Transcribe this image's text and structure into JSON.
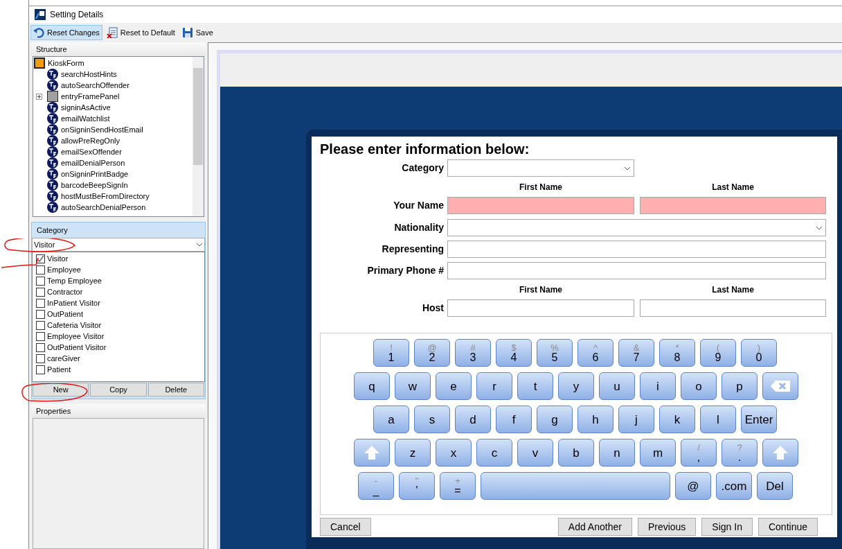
{
  "window": {
    "title": "Setting Details"
  },
  "toolbar": [
    {
      "label": "Reset Changes",
      "kind": "undo",
      "highlighted": true
    },
    {
      "label": "Reset to Default",
      "kind": "reset",
      "highlighted": false
    },
    {
      "label": "Save",
      "kind": "save",
      "highlighted": false
    }
  ],
  "structure": {
    "title": "Structure",
    "items": [
      {
        "label": "KioskForm",
        "kind": "root"
      },
      {
        "label": "searchHostHints",
        "kind": "boolean"
      },
      {
        "label": "autoSearchOffender",
        "kind": "boolean"
      },
      {
        "label": "entryFramePanel",
        "kind": "panel",
        "expanded": false
      },
      {
        "label": "signinAsActive",
        "kind": "boolean"
      },
      {
        "label": "emailWatchlist",
        "kind": "boolean"
      },
      {
        "label": "onSigninSendHostEmail",
        "kind": "boolean"
      },
      {
        "label": "allowPreRegOnly",
        "kind": "boolean"
      },
      {
        "label": "emailSexOffender",
        "kind": "boolean"
      },
      {
        "label": "emailDenialPerson",
        "kind": "boolean"
      },
      {
        "label": "onSigninPrintBadge",
        "kind": "boolean"
      },
      {
        "label": "barcodeBeepSignIn",
        "kind": "boolean"
      },
      {
        "label": "hostMustBeFromDirectory",
        "kind": "boolean"
      },
      {
        "label": "autoSearchDenialPerson",
        "kind": "boolean"
      }
    ]
  },
  "category": {
    "title": "Category",
    "value": "Visitor",
    "items": [
      {
        "label": "Visitor",
        "checked": true
      },
      {
        "label": "Employee",
        "checked": false
      },
      {
        "label": "Temp Employee",
        "checked": false
      },
      {
        "label": "Contractor",
        "checked": false
      },
      {
        "label": "InPatient Visitor",
        "checked": false
      },
      {
        "label": "OutPatient",
        "checked": false
      },
      {
        "label": "Cafeteria Visitor",
        "checked": false
      },
      {
        "label": "Employee Visitor",
        "checked": false
      },
      {
        "label": "OutPatient Visitor",
        "checked": false
      },
      {
        "label": "careGiver",
        "checked": false
      },
      {
        "label": "Patient",
        "checked": false
      }
    ],
    "buttons": [
      "New",
      "Copy",
      "Delete"
    ]
  },
  "properties": {
    "title": "Properties"
  },
  "form": {
    "heading": "Please enter information below:",
    "rows": [
      {
        "kind": "short_select",
        "label": "Category"
      },
      {
        "kind": "column_headers",
        "first": "First Name",
        "second": "Last Name"
      },
      {
        "kind": "name_pair",
        "label": "Your Name",
        "invalid": true
      },
      {
        "kind": "select",
        "label": "Nationality"
      },
      {
        "kind": "text",
        "label": "Representing"
      },
      {
        "kind": "text",
        "label": "Primary Phone #"
      },
      {
        "kind": "column_headers",
        "first": "First Name",
        "second": "Last Name"
      },
      {
        "kind": "name_pair",
        "label": "Host",
        "invalid": false
      }
    ]
  },
  "keyboard": [
    [
      {
        "kind": "char",
        "alt": "!",
        "label": "1"
      },
      {
        "kind": "char",
        "alt": "@",
        "label": "2"
      },
      {
        "kind": "char",
        "alt": "#",
        "label": "3"
      },
      {
        "kind": "char",
        "alt": "$",
        "label": "4"
      },
      {
        "kind": "char",
        "alt": "%",
        "label": "5"
      },
      {
        "kind": "char",
        "alt": "^",
        "label": "6"
      },
      {
        "kind": "char",
        "alt": "&",
        "label": "7"
      },
      {
        "kind": "char",
        "alt": "*",
        "label": "8"
      },
      {
        "kind": "char",
        "alt": "(",
        "label": "9"
      },
      {
        "kind": "char",
        "alt": ")",
        "label": "0"
      }
    ],
    [
      {
        "kind": "char",
        "label": "q"
      },
      {
        "kind": "char",
        "label": "w"
      },
      {
        "kind": "char",
        "label": "e"
      },
      {
        "kind": "char",
        "label": "r"
      },
      {
        "kind": "char",
        "label": "t"
      },
      {
        "kind": "char",
        "label": "y"
      },
      {
        "kind": "char",
        "label": "u"
      },
      {
        "kind": "char",
        "label": "i"
      },
      {
        "kind": "char",
        "label": "o"
      },
      {
        "kind": "char",
        "label": "p"
      },
      {
        "kind": "backspace"
      }
    ],
    [
      {
        "kind": "char",
        "label": "a"
      },
      {
        "kind": "char",
        "label": "s"
      },
      {
        "kind": "char",
        "label": "d"
      },
      {
        "kind": "char",
        "label": "f"
      },
      {
        "kind": "char",
        "label": "g"
      },
      {
        "kind": "char",
        "label": "h"
      },
      {
        "kind": "char",
        "label": "j"
      },
      {
        "kind": "char",
        "label": "k"
      },
      {
        "kind": "char",
        "label": "l"
      },
      {
        "kind": "char",
        "label": "Enter"
      }
    ],
    [
      {
        "kind": "shift"
      },
      {
        "kind": "char",
        "label": "z"
      },
      {
        "kind": "char",
        "label": "x"
      },
      {
        "kind": "char",
        "label": "c"
      },
      {
        "kind": "char",
        "label": "v"
      },
      {
        "kind": "char",
        "label": "b"
      },
      {
        "kind": "char",
        "label": "n"
      },
      {
        "kind": "char",
        "label": "m"
      },
      {
        "kind": "char",
        "alt": "/",
        "label": ","
      },
      {
        "kind": "char",
        "alt": "?",
        "label": "."
      },
      {
        "kind": "shift"
      }
    ],
    [
      {
        "kind": "char",
        "alt": "-",
        "label": "_"
      },
      {
        "kind": "char",
        "alt": "\"",
        "label": "'"
      },
      {
        "kind": "char",
        "alt": "+",
        "label": "="
      },
      {
        "kind": "space"
      },
      {
        "kind": "char",
        "label": "@"
      },
      {
        "kind": "char",
        "label": ".com"
      },
      {
        "kind": "char",
        "label": "Del"
      }
    ]
  ],
  "form_buttons": {
    "left": [
      "Cancel"
    ],
    "right": [
      "Add Another",
      "Previous",
      "Sign In",
      "Continue"
    ]
  }
}
